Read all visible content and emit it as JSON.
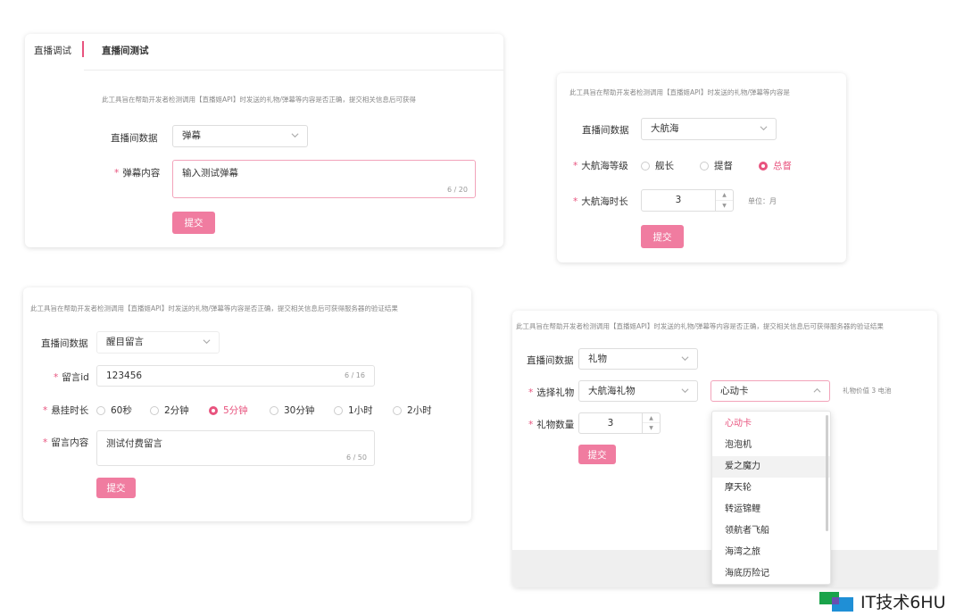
{
  "panel1": {
    "sidebar_label": "直播调试",
    "header_title": "直播间测试",
    "description": "此工具旨在帮助开发者检测调用【直播姬API】时发送的礼物/弹幕等内容是否正确，提交相关信息后可获得",
    "room_data_label": "直播间数据",
    "room_data_value": "弹幕",
    "content_label": "弹幕内容",
    "content_value": "输入测试弹幕",
    "content_count": "6 / 20",
    "submit_label": "提交"
  },
  "panel2": {
    "description": "此工具旨在帮助开发者检测调用【直播姬API】时发送的礼物/弹幕等内容是",
    "room_data_label": "直播间数据",
    "room_data_value": "大航海",
    "level_label": "大航海等级",
    "levels": [
      {
        "label": "舰长",
        "selected": false
      },
      {
        "label": "提督",
        "selected": false
      },
      {
        "label": "总督",
        "selected": true
      }
    ],
    "duration_label": "大航海时长",
    "duration_value": "3",
    "unit_text": "单位：月",
    "submit_label": "提交"
  },
  "panel3": {
    "description": "此工具旨在帮助开发者检测调用【直播姬API】时发送的礼物/弹幕等内容是否正确，提交相关信息后可获得服务器的验证结果",
    "room_data_label": "直播间数据",
    "room_data_value": "醒目留言",
    "message_id_label": "留言id",
    "message_id_value": "123456",
    "message_id_count": "6 / 16",
    "duration_label": "悬挂时长",
    "durations": [
      {
        "label": "60秒",
        "selected": false
      },
      {
        "label": "2分钟",
        "selected": false
      },
      {
        "label": "5分钟",
        "selected": true
      },
      {
        "label": "30分钟",
        "selected": false
      },
      {
        "label": "1小时",
        "selected": false
      },
      {
        "label": "2小时",
        "selected": false
      }
    ],
    "content_label": "留言内容",
    "content_value": "测试付费留言",
    "content_count": "6 / 50",
    "submit_label": "提交"
  },
  "panel4": {
    "description": "此工具旨在帮助开发者检测调用【直播姬API】时发送的礼物/弹幕等内容是否正确，提交相关信息后可获得服务器的验证结果",
    "room_data_label": "直播间数据",
    "room_data_value": "礼物",
    "gift_label": "选择礼物",
    "gift_category_value": "大航海礼物",
    "gift_value": "心动卡",
    "gift_price": "礼物价值 3 电池",
    "quantity_label": "礼物数量",
    "quantity_value": "3",
    "submit_label": "提交",
    "dropdown_items": [
      "心动卡",
      "泡泡机",
      "爱之魔力",
      "摩天轮",
      "转运锦鲤",
      "领航者飞船",
      "海湾之旅",
      "海底历险记"
    ]
  },
  "watermark": {
    "text": "IT技术6HU"
  },
  "colors": {
    "accent": "#e8537e",
    "button": "#f07ca0"
  }
}
